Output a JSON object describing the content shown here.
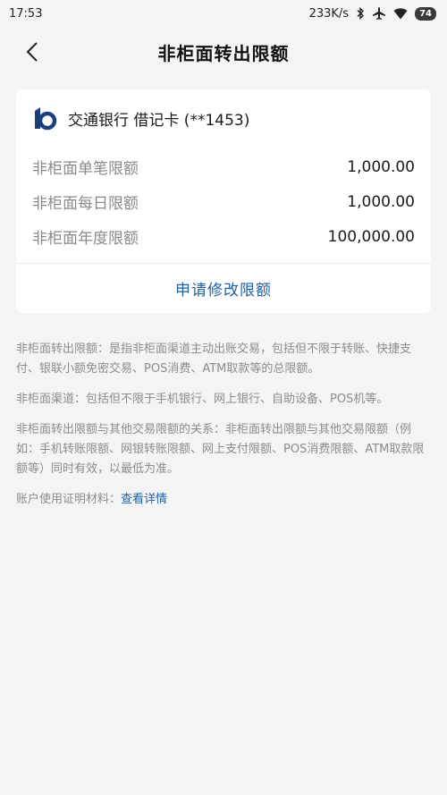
{
  "status_bar": {
    "time": "17:53",
    "speed": "233K/s",
    "battery": "74"
  },
  "header": {
    "title": "非柜面转出限额"
  },
  "card": {
    "bank_name": "交通银行 借记卡 (**1453)",
    "limits": [
      {
        "label": "非柜面单笔限额",
        "value": "1,000.00"
      },
      {
        "label": "非柜面每日限额",
        "value": "1,000.00"
      },
      {
        "label": "非柜面年度限额",
        "value": "100,000.00"
      }
    ],
    "apply_label": "申请修改限额"
  },
  "notes": {
    "p1": "非柜面转出限额：是指非柜面渠道主动出账交易，包括但不限于转账、快捷支付、银联小额免密交易、POS消费、ATM取款等的总限额。",
    "p2": "非柜面渠道：包括但不限于手机银行、网上银行、自助设备、POS机等。",
    "p3": "非柜面转出限额与其他交易限额的关系：非柜面转出限额与其他交易限额（例如：手机转账限额、网银转账限额、网上支付限额、POS消费限额、ATM取款限额等）同时有效，以最低为准。",
    "p4_label": "账户使用证明材料：",
    "p4_link": "查看详情"
  },
  "colors": {
    "accent": "#1f5fa8",
    "background": "#f4f4f6",
    "card": "#ffffff",
    "muted_text": "#8a8a8a"
  }
}
